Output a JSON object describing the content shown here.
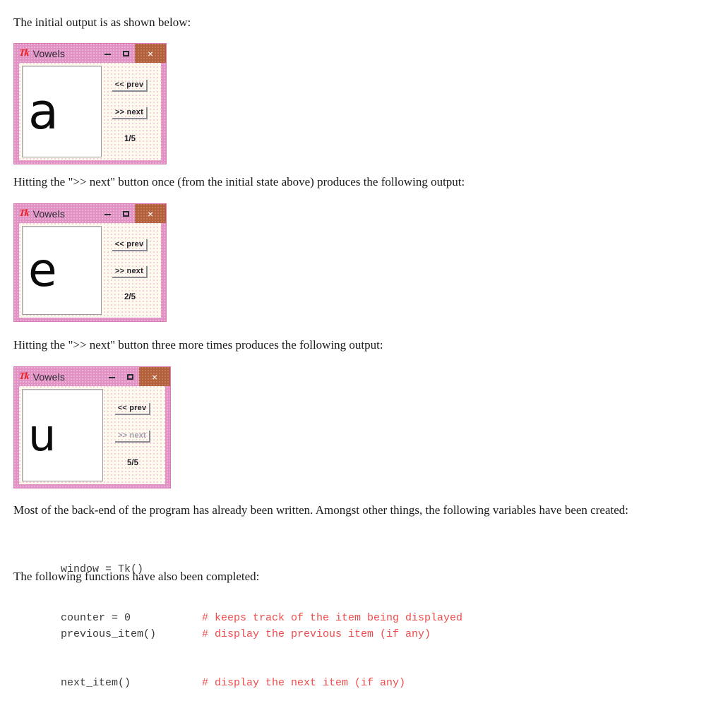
{
  "paragraphs": {
    "intro": "The initial output is as shown below:",
    "after_first": "Hitting the \">> next\" button once (from the initial state above) produces the following output:",
    "after_three": "Hitting the \">> next\" button three more times produces the following output:",
    "backend": "Most of the back-end of the program has already been written.  Amongst other things, the following variables have been created:",
    "functions_intro": "The following functions have also been completed:"
  },
  "window_common": {
    "title": "Vowels",
    "logo": "Tk",
    "minimize_label": "minimize",
    "maximize_label": "maximize",
    "close_label": "×",
    "prev_label": "<< prev",
    "next_label": ">> next"
  },
  "windows": [
    {
      "id": "window-initial",
      "title": "Vowels",
      "letter": "a",
      "counter": "1/5",
      "prev_label": "<< prev",
      "next_label": ">> next",
      "prev_disabled": false,
      "next_disabled": false
    },
    {
      "id": "window-after-one-next",
      "title": "Vowels",
      "letter": "e",
      "counter": "2/5",
      "prev_label": "<< prev",
      "next_label": ">> next",
      "prev_disabled": false,
      "next_disabled": false
    },
    {
      "id": "window-last-item",
      "title": "Vowels",
      "letter": "u",
      "counter": "5/5",
      "prev_label": "<< prev",
      "next_label": ">> next",
      "prev_disabled": false,
      "next_disabled": true
    }
  ],
  "code_variables": [
    {
      "name": "window = Tk()",
      "comment": ""
    },
    {
      "name": "counter = 0",
      "comment": "# keeps track of the item being displayed"
    }
  ],
  "code_functions": [
    {
      "name": "previous_item()",
      "comment": "# display the previous item (if any)"
    },
    {
      "name": "next_item()",
      "comment": "# display the next item (if any)"
    }
  ],
  "colors": {
    "window_pink": "#e291c4",
    "close_brown": "#b4603a",
    "body_cream": "#fdfaee",
    "tk_logo_red": "#e8221f",
    "comment_red": "#ef4b4b"
  }
}
